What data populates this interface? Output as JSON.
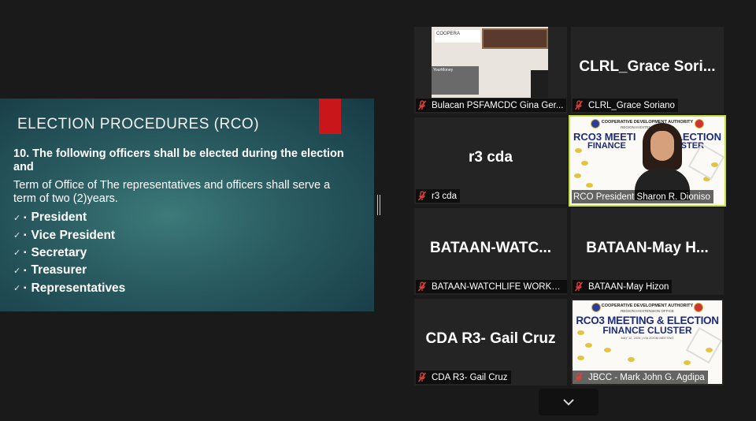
{
  "slide": {
    "title": "ELECTION PROCEDURES  (RCO)",
    "heading": "10. The following officers shall be elected during the election and",
    "body": "Term of Office  of The representatives and officers shall serve a term of two (2)years.",
    "items": [
      "President",
      "Vice President",
      "Secretary",
      "Treasurer",
      "Representatives"
    ],
    "check_glyph": "✓",
    "bullet_glyph": "▪",
    "accent_color": "#c8161b"
  },
  "participants": [
    {
      "nameplate": "Bulacan PSFAMCDC Gina Ger...",
      "display": "",
      "video": "office"
    },
    {
      "nameplate": "CLRL_Grace Soriano",
      "display": "CLRL_Grace  Sori..."
    },
    {
      "nameplate": "r3 cda",
      "display": "r3 cda"
    },
    {
      "nameplate": "RCO President  Sharon R. Dioniso",
      "display": "",
      "video": "speaker",
      "active": true
    },
    {
      "nameplate": "BATAAN-WATCHLIFE WORKER...",
      "display": "BATAAN-WATC..."
    },
    {
      "nameplate": "BATAAN-May Hizon",
      "display": "BATAAN-May  H..."
    },
    {
      "nameplate": "CDA R3- Gail Cruz",
      "display": "CDA R3- Gail Cruz"
    },
    {
      "nameplate": "JBCC - Mark John G. Agdipa",
      "display": "",
      "video": "banner"
    }
  ],
  "video_text": {
    "office_banner": "COOPERA",
    "office_poster": "YourMoney",
    "banner_org": "COOPERATIVE DEVELOPMENT AUTHORITY",
    "banner_sub": "REGION III EXTENSION OFFICE",
    "banner_title_1": "RCO3 MEETING & ELECTION",
    "banner_title_2": "FINANCE CLUSTER",
    "banner_date": "MAY 12, 2024 | VIA ZOOM MEETING",
    "speaker_title_1": "RCO3 MEETI",
    "speaker_title_2": "LECTION",
    "speaker_title_3": "FINANCE",
    "speaker_title_4": "USTER"
  },
  "icons": {
    "mic": "microphone-muted-icon",
    "scroll": "chevron-down-icon"
  },
  "colors": {
    "active_speaker": "#c6e03b",
    "muted_mic": "#e0403a"
  }
}
